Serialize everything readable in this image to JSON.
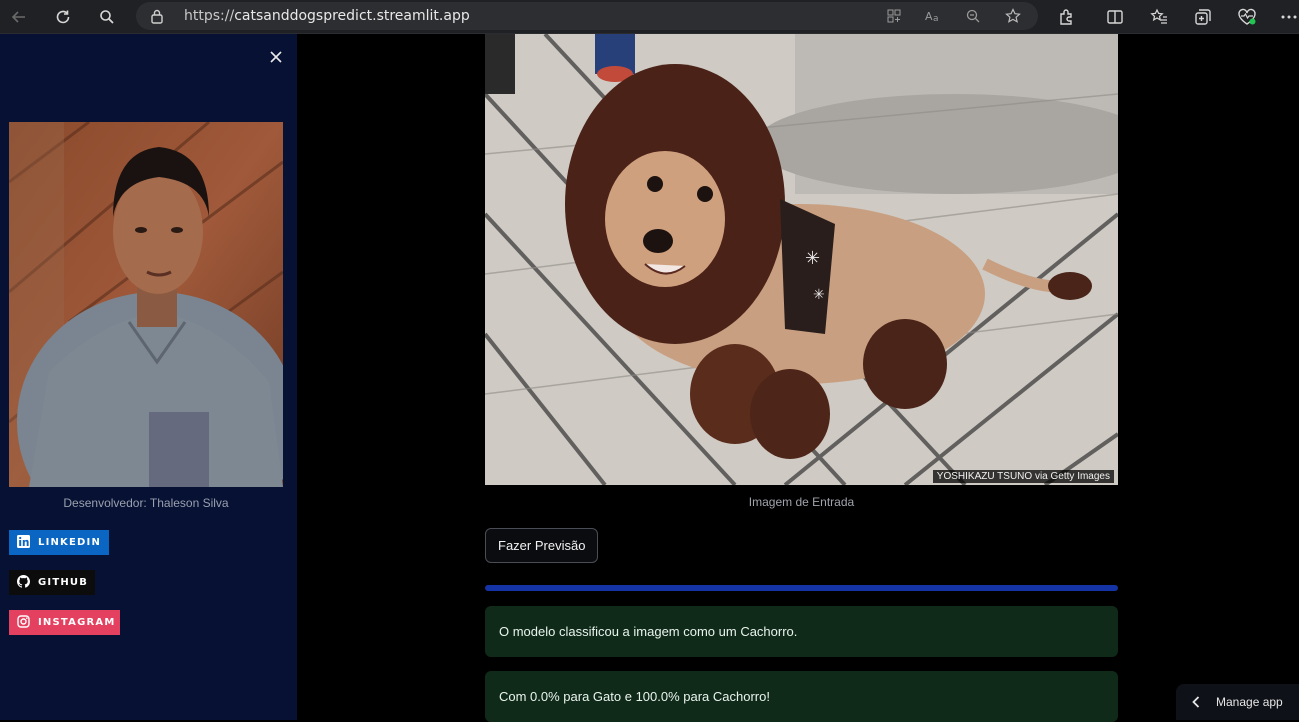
{
  "browser": {
    "url_scheme": "https://",
    "url_host": "catsanddogspredict.streamlit.app",
    "back_icon": "arrow-left-icon",
    "refresh_icon": "refresh-icon",
    "search_icon": "search-icon"
  },
  "sidebar": {
    "developer_caption": "Desenvolvedor: Thaleson Silva",
    "badges": [
      {
        "label": "LINKEDIN",
        "color": "#0a66c2"
      },
      {
        "label": "GITHUB",
        "color": "#0d0c0c"
      },
      {
        "label": "INSTAGRAM",
        "color": "#e4405f"
      }
    ]
  },
  "main": {
    "image_credit": "YOSHIKAZU TSUNO via Getty Images",
    "image_caption": "Imagem de Entrada",
    "predict_button": "Fazer Previsão",
    "progress_fraction": 1.0,
    "result_message": "O modelo classificou a imagem como um Cachorro.",
    "probability_message": "Com 0.0% para Gato e 100.0% para Cachorro!"
  },
  "footer": {
    "manage_app": "Manage app"
  },
  "colors": {
    "sidebar_bg": "#061133",
    "progress_fill": "#1433a5",
    "success_bg": "#102a1a"
  }
}
